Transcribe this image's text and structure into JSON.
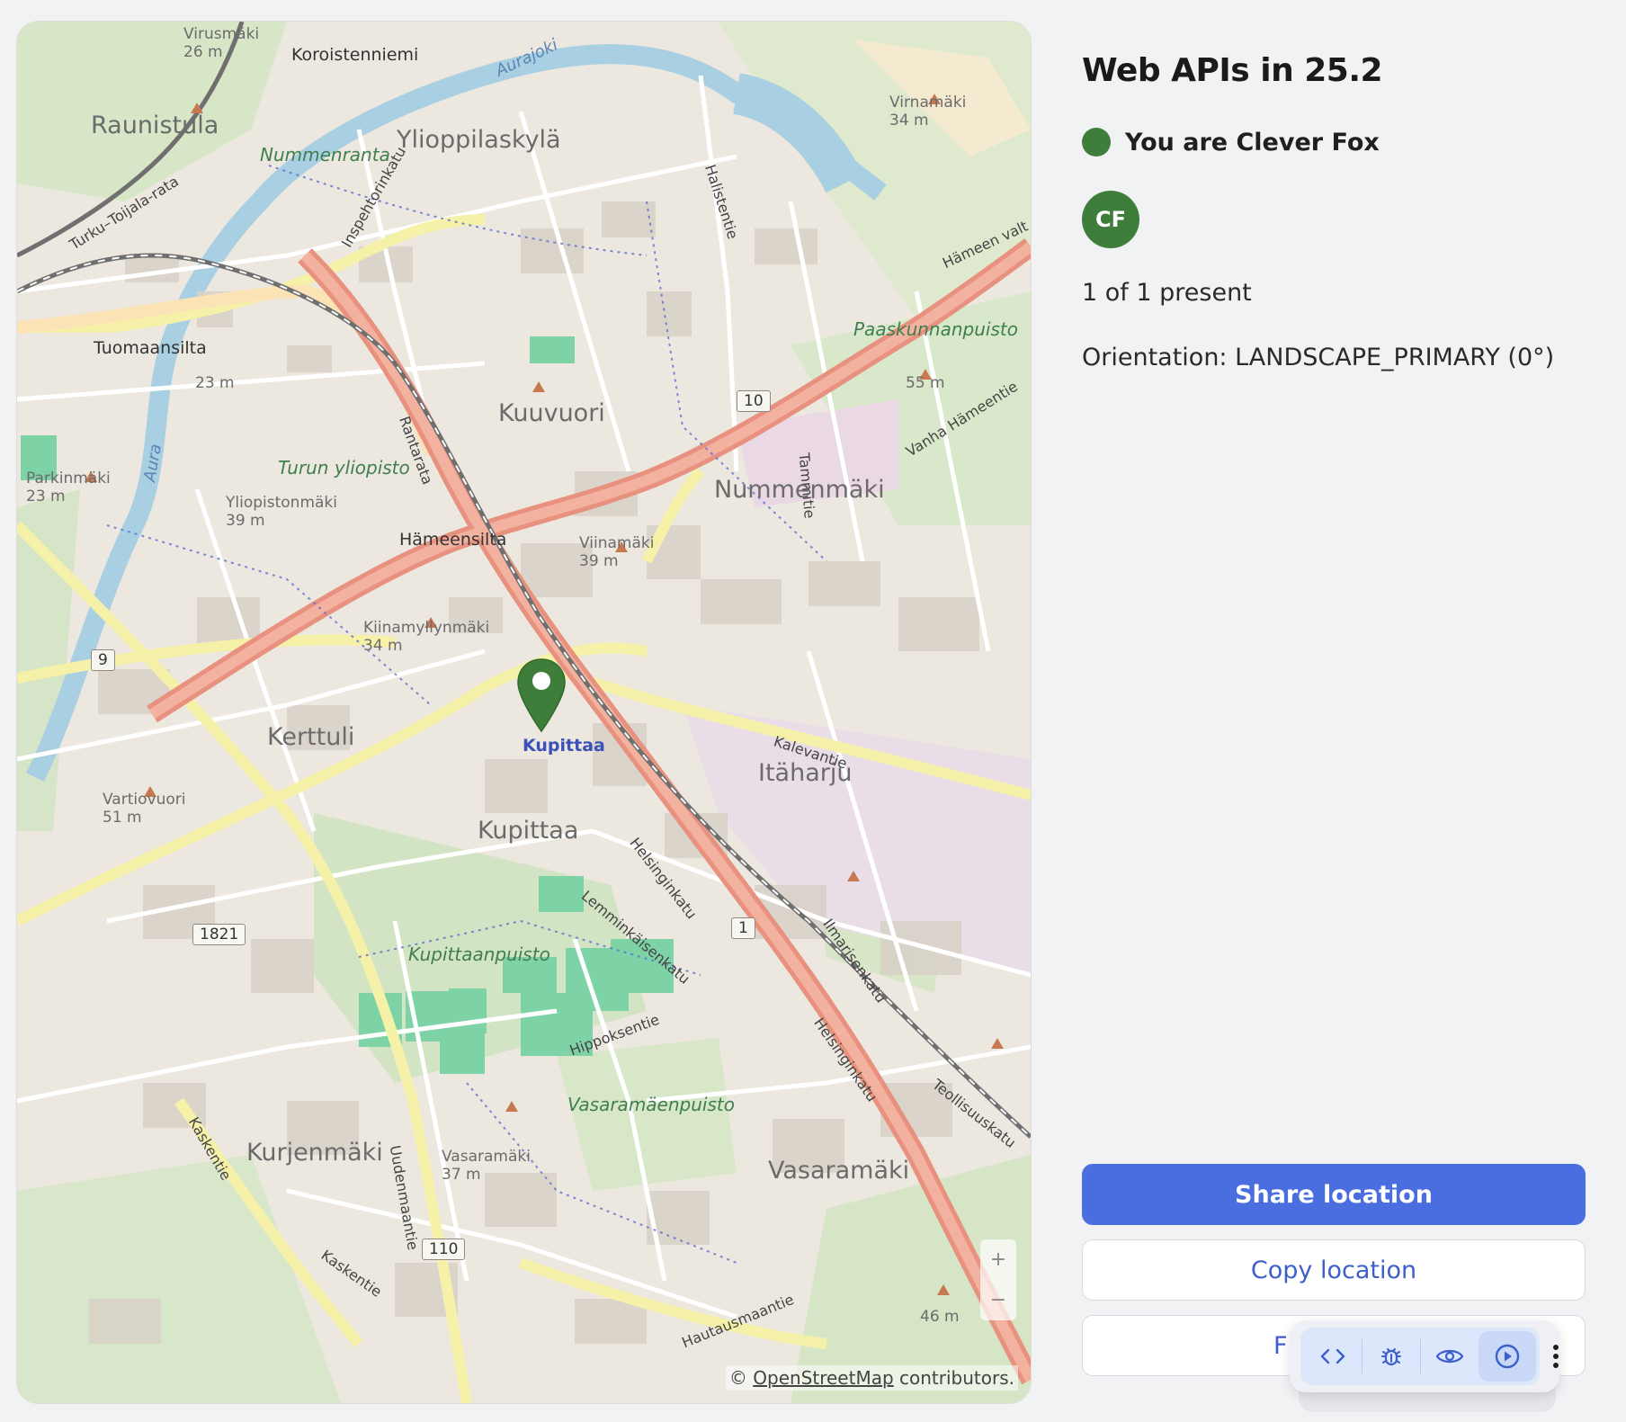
{
  "map": {
    "districts": [
      "Raunistula",
      "Ylioppilaskylä",
      "Kuuvuori",
      "Nummenmäki",
      "Kerttuli",
      "Itäharju",
      "Kupittaa",
      "Kurjenmäki",
      "Vasaramäki"
    ],
    "places": [
      "Koroistenniemi",
      "Tuomaansilta",
      "Hämeensilta"
    ],
    "peaks": {
      "virusmaki": "Virusmäki\n26 m",
      "virnamaki": "Virnamäki\n34 m",
      "tuomaansilta_h": "23 m",
      "parkinmaki": "Parkinmäki\n23 m",
      "yliopistonmaki": "Yliopistonmäki\n39 m",
      "viinamaki": "Viinamäki\n39 m",
      "kiinamyllynmaki": "Kiinamyllynmäki\n34 m",
      "vartiovuori": "Vartiovuori\n51 m",
      "vasaramaki": "Vasaramäki\n37 m",
      "paaskunnan_h": "55 m",
      "hautaus_h": "46 m"
    },
    "parks": [
      "Nummenranta",
      "Turun yliopisto",
      "Kupittaanpuisto",
      "Vasaramäenpuisto",
      "Paaskunnanpuisto"
    ],
    "water": [
      "Aurajoki",
      "Aura"
    ],
    "streets": [
      "Inspehtorinkatu",
      "Rantarata",
      "Halistentie",
      "Tammitie",
      "Hämeen valt",
      "Vanha Hämeentie",
      "Kalevantie",
      "Helsinginkatu",
      "Lemminkäisenkatu",
      "Ilmarisenkatu",
      "Hippoksentie",
      "Teollisuuskatu",
      "Kaskentie",
      "Uudenmaantie",
      "Hautausmaantie",
      "Turku–Toijala-rata"
    ],
    "station": "Kupittaa",
    "shields": [
      "10",
      "9",
      "1821",
      "1",
      "110"
    ],
    "attribution_prefix": "© ",
    "attribution_link": "OpenStreetMap",
    "attribution_suffix": " contributors."
  },
  "panel": {
    "title": "Web APIs in 25.2",
    "user_label": "You are Clever Fox",
    "user_color": "#3f7e3a",
    "avatar_initials": "CF",
    "presence": "1 of 1 present",
    "orientation": "Orientation: LANDSCAPE_PRIMARY (0°)",
    "buttons": {
      "share": "Share location",
      "copy": "Copy location",
      "third": "F"
    }
  },
  "devtools": {
    "icons": [
      "code-icon",
      "bug-icon",
      "eye-icon",
      "play-icon",
      "more-vertical-icon"
    ]
  },
  "colors": {
    "primary": "#4a6ee0",
    "marker": "#3f7e3a"
  }
}
